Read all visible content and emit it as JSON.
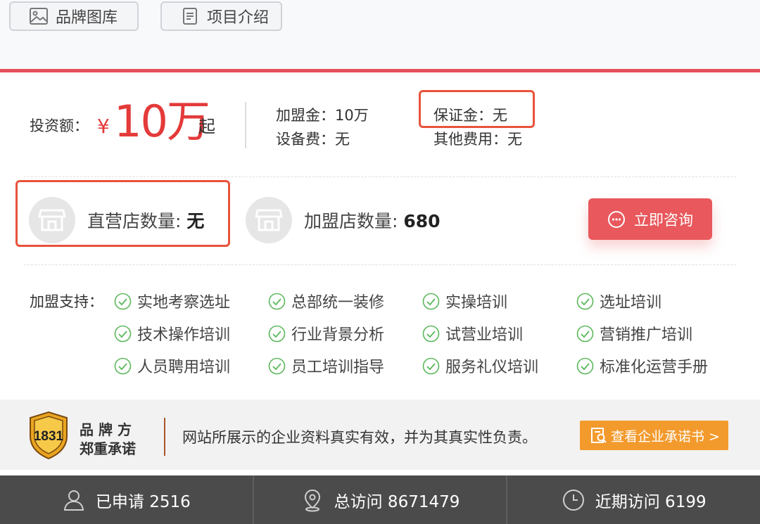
{
  "tabs": [
    {
      "label": "品牌图库",
      "icon": "image-icon"
    },
    {
      "label": "项目介绍",
      "icon": "document-icon"
    }
  ],
  "investment": {
    "label": "投资额：",
    "currency": "¥",
    "amount": "10万",
    "suffix": "起"
  },
  "fees": {
    "join": "加盟金：10万",
    "equipment": "设备费：无",
    "deposit": "保证金：无",
    "other": "其他费用：无"
  },
  "stores": {
    "direct_label": "直营店数量: ",
    "direct_value": "无",
    "franchise_label": "加盟店数量: ",
    "franchise_value": "680"
  },
  "consult_button": "立即咨询",
  "support": {
    "label": "加盟支持：",
    "items": [
      "实地考察选址",
      "总部统一装修",
      "实操培训",
      "选址培训",
      "技术操作培训",
      "行业背景分析",
      "试营业培训",
      "营销推广培训",
      "人员聘用培训",
      "员工培训指导",
      "服务礼仪培训",
      "标准化运营手册"
    ]
  },
  "brand": {
    "badge_number": "1831",
    "title_line1": "品牌方",
    "title_line2": "郑重承诺",
    "statement": "网站所展示的企业资料真实有效，并为其真实性负责。",
    "pledge_button": "查看企业承诺书 >"
  },
  "stats": [
    {
      "label": "已申请 2516",
      "icon": "user-icon"
    },
    {
      "label": "总访问 8671479",
      "icon": "location-pin-icon"
    },
    {
      "label": "近期访问 6199",
      "icon": "clock-icon"
    }
  ],
  "colors": {
    "accent_red": "#e43a3a",
    "highlight_box": "#e8533b",
    "consult_button": "#e8585c",
    "pledge_button": "#f39a2d",
    "check_green": "#5cb85c",
    "stats_bar": "#4b4b4b"
  }
}
